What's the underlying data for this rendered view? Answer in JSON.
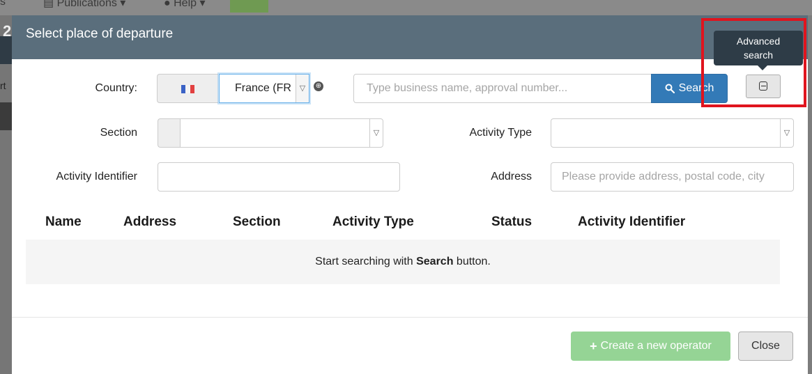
{
  "backdrop": {
    "left_fragment": "s",
    "publications_label": "Publications",
    "help_label": "Help",
    "left_char1": "2",
    "left_char2": "rt"
  },
  "modal": {
    "title": "Select place of departure",
    "country_label": "Country:",
    "country_value": "France (FR",
    "search_placeholder": "Type business name, approval number...",
    "search_button_label": "Search",
    "advanced_tooltip_line1": "Advanced",
    "advanced_tooltip_line2": "search",
    "section_label": "Section",
    "activity_type_label": "Activity Type",
    "activity_identifier_label": "Activity Identifier",
    "address_label": "Address",
    "address_placeholder": "Please provide address, postal code, city",
    "table": {
      "columns": [
        "Name",
        "Address",
        "Section",
        "Activity Type",
        "Status",
        "Activity Identifier"
      ],
      "empty_message": {
        "prefix": "Start searching with ",
        "bold": "Search",
        "suffix": " button."
      }
    },
    "create_button_label": "Create a new operator",
    "close_button_label": "Close"
  },
  "colors": {
    "header": "#5a6e7c",
    "primary": "#337ab7",
    "success_disabled": "#95d495",
    "highlight_box": "#e0141e",
    "tooltip": "#2e3c47"
  },
  "icons": [
    "france-flag-icon",
    "globe-icon",
    "search-icon",
    "chevron-down-icon",
    "collapse-icon",
    "plus-icon"
  ]
}
